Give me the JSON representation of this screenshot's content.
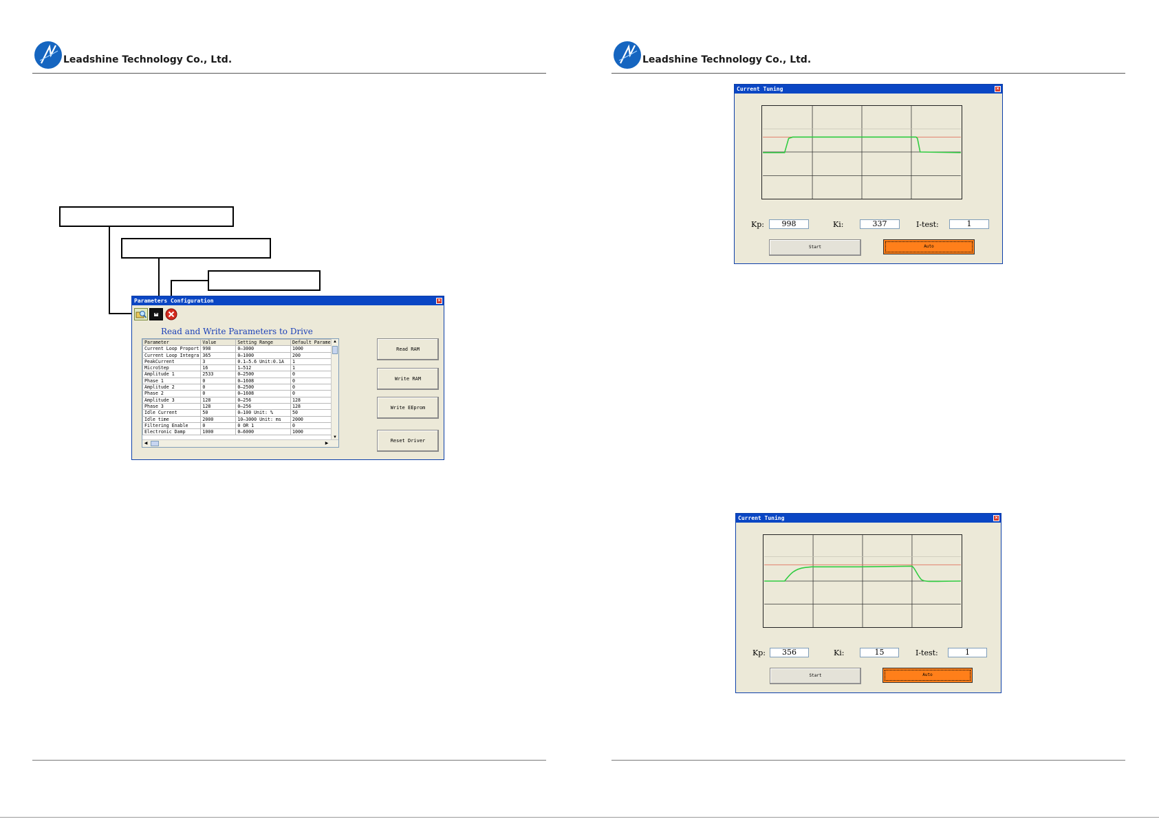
{
  "header": {
    "company": "Leadshine Technology Co., Ltd."
  },
  "params_window": {
    "title": "Parameters Configuration",
    "heading": "Read and Write Parameters to Drive",
    "columns": [
      "Parameter",
      "Value",
      "Setting Range",
      "Default Paramete"
    ],
    "rows": [
      [
        "Current Loop Proport",
        "998",
        "0—3000",
        "1000"
      ],
      [
        "Current Loop Integra",
        "365",
        "0—1000",
        "200"
      ],
      [
        "PeakCurrent",
        "3",
        "0.1—5.6 Unit:0.1A",
        "1"
      ],
      [
        "MicroStep",
        "16",
        "1—512",
        "1"
      ],
      [
        "Amplitude 1",
        "2533",
        "0—2500",
        "0"
      ],
      [
        "Phase 1",
        "0",
        "0—1608",
        "0"
      ],
      [
        "Amplitude 2",
        "0",
        "0—2500",
        "0"
      ],
      [
        "Phase 2",
        "0",
        "0—1608",
        "0"
      ],
      [
        "Amplitude 3",
        "128",
        "0—256",
        "128"
      ],
      [
        "Phase 3",
        "128",
        "0—256",
        "128"
      ],
      [
        "Idle Current",
        "50",
        "0—100 Unit: %",
        "50"
      ],
      [
        "Idle time",
        "2000",
        "10—3000 Unit: ms",
        "2000"
      ],
      [
        "Filtering Enable",
        "0",
        "0 OR 1",
        "0"
      ],
      [
        "Electronic Damp",
        "1000",
        "0—6000",
        "1000"
      ]
    ],
    "buttons": {
      "read_ram": "Read RAM",
      "write_ram": "Write RAM",
      "write_eeprom": "Write EEprom",
      "reset_driver": "Reset Driver"
    },
    "icons": [
      "open-file-icon",
      "save-icon",
      "exit-icon"
    ]
  },
  "tuning_windows": [
    {
      "title": "Current Tuning",
      "kp_label": "Kp:",
      "kp": "998",
      "ki_label": "Ki:",
      "ki": "337",
      "itest_label": "I-test:",
      "itest": "1",
      "start_label": "Start",
      "auto_label": "Auto"
    },
    {
      "title": "Current Tuning",
      "kp_label": "Kp:",
      "kp": "356",
      "ki_label": "Ki:",
      "ki": "15",
      "itest_label": "I-test:",
      "itest": "1",
      "start_label": "Start",
      "auto_label": "Auto"
    }
  ],
  "colors": {
    "titlebar": "#0a46c4",
    "response": "#2ecc40",
    "target": "#e0705a",
    "auto_button": "#ff7f1a",
    "window_bg": "#ece9d8"
  }
}
